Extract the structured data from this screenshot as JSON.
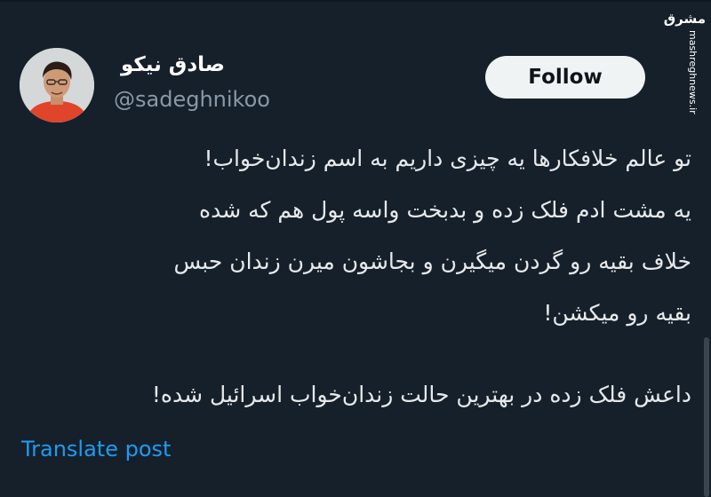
{
  "tweet": {
    "author": {
      "display_name": "صادق نیکو",
      "handle": "@sadeghnikoo"
    },
    "follow_label": "Follow",
    "text_lines": [
      "تو عالم خلافکارها یه چیزی داریم به اسم زندان‌خواب!",
      "یه مشت ادم فلک زده و بدبخت واسه پول هم که شده",
      "خلاف بقیه رو گردن میگیرن و بجاشون میرن زندان حبس",
      "بقیه رو میکشن!",
      "داعش فلک زده در بهترین حالت زندان‌خواب اسرائیل شده!"
    ],
    "translate_label": "Translate post"
  },
  "watermark": {
    "logo": "مشرق",
    "url": "mashreghnews.ir"
  },
  "colors": {
    "background": "#15202b",
    "text": "#e7e9ea",
    "secondary": "#8b98a5",
    "link": "#1d9bf0",
    "button_bg": "#eff3f4"
  }
}
